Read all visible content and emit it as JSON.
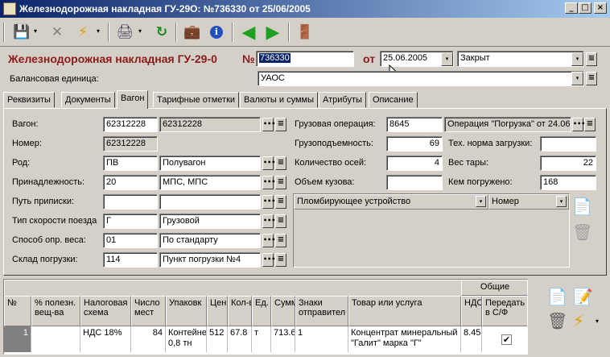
{
  "window": {
    "title": "Железнодорожная накладная ГУ-29О:  №736330 от 25/06/2005",
    "min_label": "_",
    "max_label": "□",
    "close_label": "×"
  },
  "toolbar": {
    "save_icon": "💾",
    "delete_icon": "✕",
    "action_icon": "⚡",
    "print_icon": "🖨",
    "refresh_icon": "↻",
    "briefcase_icon": "💼",
    "info_icon": "i",
    "back_icon": "◀",
    "forward_icon": "▶",
    "exit_icon": "🚪",
    "dropdown_glyph": "▾"
  },
  "header": {
    "doc_label": "Железнодорожная накладная ГУ-29-0",
    "number_label": "№",
    "number_value": "736330",
    "date_label": "от",
    "date_value": "25.06.2005",
    "status_value": "Закрыт",
    "balance_label": "Балансовая единица:",
    "balance_value": "УАОС"
  },
  "tabs": [
    {
      "label": "Реквизиты"
    },
    {
      "label": "Документы"
    },
    {
      "label": "Вагон"
    },
    {
      "label": "Тарифные отметки"
    },
    {
      "label": "Валюты и суммы"
    },
    {
      "label": "Атрибуты"
    },
    {
      "label": "Описание"
    }
  ],
  "wagon": {
    "vagon_label": "Вагон:",
    "vagon_code": "62312228",
    "vagon_name": "62312228",
    "nomer_label": "Номер:",
    "nomer_value": "62312228",
    "rod_label": "Род:",
    "rod_code": "ПВ",
    "rod_name": "Полувагон",
    "prinad_label": "Принадлежность:",
    "prinad_code": "20",
    "prinad_name": "МПС, МПС",
    "put_label": "Путь приписки:",
    "put_code": "",
    "put_name": "",
    "tip_label": "Тип скорости поезда",
    "tip_code": "Г",
    "tip_name": "Грузовой",
    "sposob_label": "Способ опр. веса:",
    "sposob_code": "01",
    "sposob_name": "По стандарту",
    "sklad_label": "Склад погрузки:",
    "sklad_code": "114",
    "sklad_name": "Пункт погрузки №4",
    "gruz_op_label": "Грузовая операция:",
    "gruz_op_code": "8645",
    "gruz_op_name": "Операция \"Погрузка\" от 24.06",
    "gruzopod_label": "Грузоподъемность:",
    "gruzopod_value": "69",
    "tech_label": "Тех. норма загрузки:",
    "tech_value": "",
    "osi_label": "Количество осей:",
    "osi_value": "4",
    "ves_label": "Вес тары:",
    "ves_value": "22",
    "obem_label": "Объем кузова:",
    "obem_value": "",
    "kem_label": "Кем погружено:",
    "kem_value": "168",
    "seal_col1": "Пломбирующее устройство",
    "seal_col2": "Номер"
  },
  "goods": {
    "group_header": "Общие",
    "columns": [
      "№",
      "% полезн. вещ-ва",
      "Налоговая схема",
      "Число мест",
      "Упаковк",
      "Цен",
      "Кол-в",
      "Ед.",
      "Сумм",
      "Знаки отправител",
      "Товар или услуга",
      "НДС",
      "Передать в С/Ф"
    ],
    "rows": [
      {
        "no": "1",
        "pct": "",
        "tax": "НДС 18%",
        "places": "84",
        "pack": "Контейне 0,8 тн",
        "price": "512",
        "qty": "67.8",
        "unit": "т",
        "sum": "713.6",
        "marks": "1",
        "product": "Концентрат минеральный \"Галит\" марка \"Г\"",
        "nds": "8.45",
        "transfer": "✔"
      }
    ]
  },
  "side_icons": {
    "new_doc": "📄",
    "trash": "🗑",
    "edit": "📝",
    "lightning": "⚡"
  },
  "colors": {
    "title_start": "#0a246a",
    "title_end": "#a6caf0",
    "header_text": "#8b1a1a",
    "arrow_green": "#20a020"
  }
}
